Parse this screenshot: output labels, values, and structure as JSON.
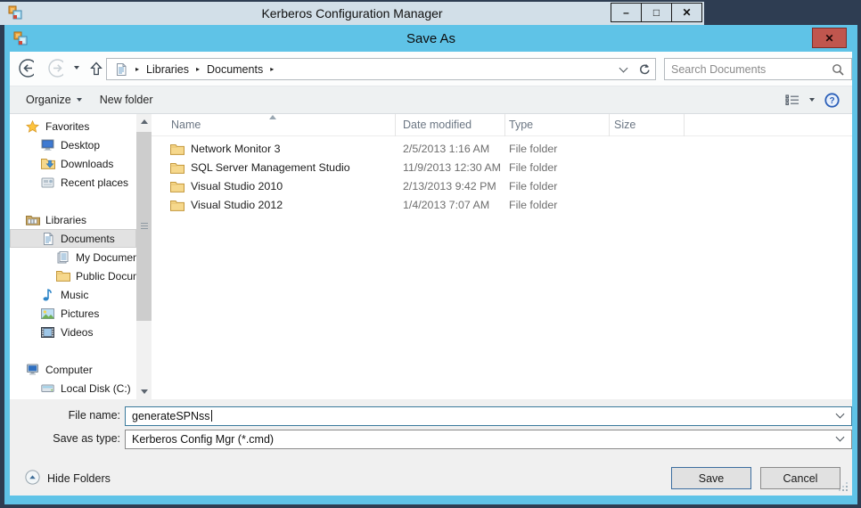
{
  "window": {
    "title": "Kerberos Configuration Manager",
    "controls": [
      {
        "name": "minimize",
        "glyph": "–"
      },
      {
        "name": "maximize",
        "glyph": "□"
      },
      {
        "name": "close",
        "glyph": "✕"
      }
    ]
  },
  "dialog": {
    "title": "Save As",
    "close_glyph": "✕",
    "nav": {
      "breadcrumb": {
        "arrow_glyph": "▸",
        "root_icon": "document",
        "items": [
          "Libraries",
          "Documents"
        ]
      },
      "search": {
        "placeholder": "Search Documents"
      }
    },
    "toolbar": {
      "organize_label": "Organize",
      "new_folder_label": "New folder"
    },
    "sidebar": {
      "sections": [
        {
          "items": [
            {
              "label": "Favorites",
              "icon": "star",
              "indent": 0
            },
            {
              "label": "Desktop",
              "icon": "desktop",
              "indent": 1
            },
            {
              "label": "Downloads",
              "icon": "downloads",
              "indent": 1
            },
            {
              "label": "Recent places",
              "icon": "recent-places",
              "indent": 1
            }
          ]
        },
        {
          "items": [
            {
              "label": "Libraries",
              "icon": "libraries",
              "indent": 0
            },
            {
              "label": "Documents",
              "icon": "document",
              "indent": 1,
              "selected": true
            },
            {
              "label": "My Documents",
              "icon": "my-documents",
              "indent": 2
            },
            {
              "label": "Public Docume",
              "icon": "folder",
              "indent": 2
            },
            {
              "label": "Music",
              "icon": "music",
              "indent": 1
            },
            {
              "label": "Pictures",
              "icon": "pictures",
              "indent": 1
            },
            {
              "label": "Videos",
              "icon": "videos",
              "indent": 1
            }
          ]
        },
        {
          "items": [
            {
              "label": "Computer",
              "icon": "computer",
              "indent": 0
            },
            {
              "label": "Local Disk (C:)",
              "icon": "disk",
              "indent": 1
            }
          ]
        }
      ]
    },
    "file_list": {
      "columns": [
        {
          "label": "Name",
          "sort": "asc"
        },
        {
          "label": "Date modified"
        },
        {
          "label": "Type"
        },
        {
          "label": "Size"
        }
      ],
      "rows": [
        {
          "name": "Network Monitor 3",
          "date_modified": "2/5/2013 1:16 AM",
          "type": "File folder",
          "size": ""
        },
        {
          "name": "SQL Server Management Studio",
          "date_modified": "11/9/2013 12:30 AM",
          "type": "File folder",
          "size": ""
        },
        {
          "name": "Visual Studio 2010",
          "date_modified": "2/13/2013 9:42 PM",
          "type": "File folder",
          "size": ""
        },
        {
          "name": "Visual Studio 2012",
          "date_modified": "1/4/2013 7:07 AM",
          "type": "File folder",
          "size": ""
        }
      ]
    },
    "fields": {
      "file_name_label": "File name:",
      "file_name_value": "generateSPNss",
      "save_as_type_label": "Save as type:",
      "save_as_type_value": "Kerberos Config Mgr (*.cmd)"
    },
    "footer": {
      "hide_folders_label": "Hide Folders",
      "save_label": "Save",
      "cancel_label": "Cancel"
    }
  },
  "colors": {
    "desktop_background": "#2e3d52",
    "dialog_chrome": "#5fc3e7",
    "app_titlebar": "#d2dfe8",
    "close_button": "#c0564e",
    "focused_field_border": "#3a7a9c",
    "selection": "#e2e2e2"
  }
}
